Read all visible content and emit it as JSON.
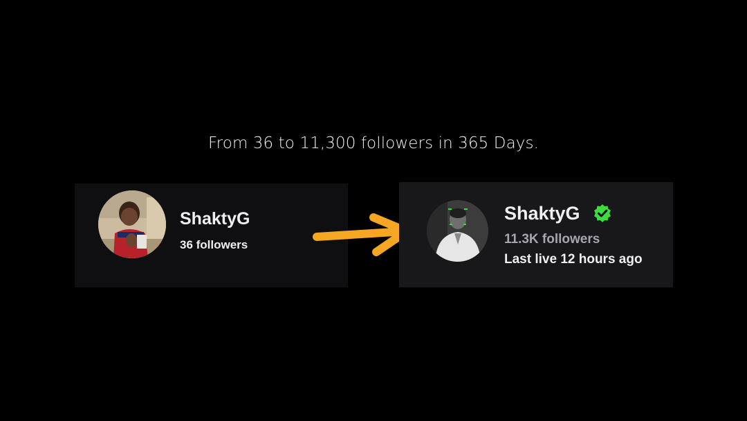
{
  "headline": "From 36 to 11,300 followers in 365 Days.",
  "before": {
    "username": "ShaktyG",
    "followers": "36 followers",
    "avatar": "child-photo-avatar"
  },
  "after": {
    "username": "ShaktyG",
    "followers": "11.3K followers",
    "last_live": "Last live 12 hours ago",
    "avatar": "adult-photo-avatar",
    "badge": "verified-check-icon"
  },
  "colors": {
    "background": "#000000",
    "card_before": "#0f0f12",
    "card_after": "#18181b",
    "arrow": "#f5a623",
    "verified": "#3ddc3d",
    "muted_text": "#a6a6ad"
  }
}
